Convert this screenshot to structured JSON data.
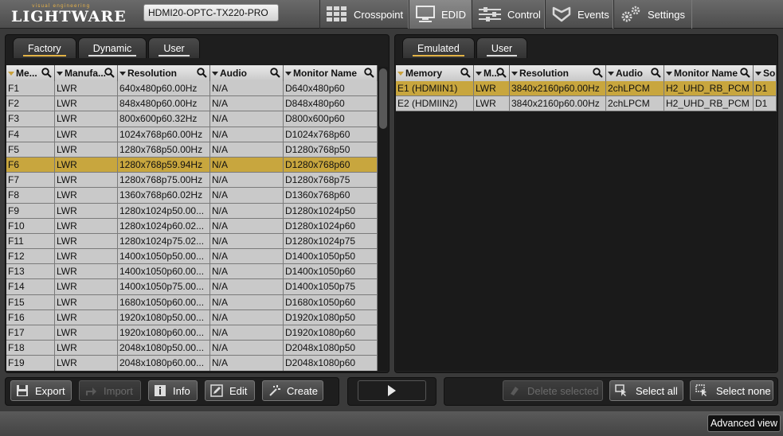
{
  "app": {
    "logo_small": "visual engineering",
    "logo": "LIGHTWARE",
    "device": "HDMI20-OPTC-TX220-PRO"
  },
  "nav": [
    {
      "label": "Crosspoint",
      "icon": "crosspoint-grid-icon"
    },
    {
      "label": "EDID",
      "icon": "monitor-icon"
    },
    {
      "label": "Control",
      "icon": "sliders-icon"
    },
    {
      "label": "Events",
      "icon": "events-chevron-icon"
    },
    {
      "label": "Settings",
      "icon": "gears-icon"
    }
  ],
  "left_tabs": [
    "Factory",
    "Dynamic",
    "User"
  ],
  "right_tabs": [
    "Emulated",
    "User"
  ],
  "left_headers": [
    "Me...",
    "Manufa...",
    "Resolution",
    "Audio",
    "Monitor Name"
  ],
  "right_headers": [
    "Memory",
    "M...",
    "Resolution",
    "Audio",
    "Monitor Name",
    "So..."
  ],
  "left_rows": [
    [
      "F1",
      "LWR",
      "640x480p60.00Hz",
      "N/A",
      "D640x480p60"
    ],
    [
      "F2",
      "LWR",
      "848x480p60.00Hz",
      "N/A",
      "D848x480p60"
    ],
    [
      "F3",
      "LWR",
      "800x600p60.32Hz",
      "N/A",
      "D800x600p60"
    ],
    [
      "F4",
      "LWR",
      "1024x768p60.00Hz",
      "N/A",
      "D1024x768p60"
    ],
    [
      "F5",
      "LWR",
      "1280x768p50.00Hz",
      "N/A",
      "D1280x768p50"
    ],
    [
      "F6",
      "LWR",
      "1280x768p59.94Hz",
      "N/A",
      "D1280x768p60"
    ],
    [
      "F7",
      "LWR",
      "1280x768p75.00Hz",
      "N/A",
      "D1280x768p75"
    ],
    [
      "F8",
      "LWR",
      "1360x768p60.02Hz",
      "N/A",
      "D1360x768p60"
    ],
    [
      "F9",
      "LWR",
      "1280x1024p50.00...",
      "N/A",
      "D1280x1024p50"
    ],
    [
      "F10",
      "LWR",
      "1280x1024p60.02...",
      "N/A",
      "D1280x1024p60"
    ],
    [
      "F11",
      "LWR",
      "1280x1024p75.02...",
      "N/A",
      "D1280x1024p75"
    ],
    [
      "F12",
      "LWR",
      "1400x1050p50.00...",
      "N/A",
      "D1400x1050p50"
    ],
    [
      "F13",
      "LWR",
      "1400x1050p60.00...",
      "N/A",
      "D1400x1050p60"
    ],
    [
      "F14",
      "LWR",
      "1400x1050p75.00...",
      "N/A",
      "D1400x1050p75"
    ],
    [
      "F15",
      "LWR",
      "1680x1050p60.00...",
      "N/A",
      "D1680x1050p60"
    ],
    [
      "F16",
      "LWR",
      "1920x1080p50.00...",
      "N/A",
      "D1920x1080p50"
    ],
    [
      "F17",
      "LWR",
      "1920x1080p60.00...",
      "N/A",
      "D1920x1080p60"
    ],
    [
      "F18",
      "LWR",
      "2048x1080p50.00...",
      "N/A",
      "D2048x1080p50"
    ],
    [
      "F19",
      "LWR",
      "2048x1080p60.00...",
      "N/A",
      "D2048x1080p60"
    ]
  ],
  "left_selected": 5,
  "right_rows": [
    [
      "E1 (HDMIIN1)",
      "LWR",
      "3840x2160p60.00Hz",
      "2chLPCM",
      "H2_UHD_RB_PCM",
      "D1"
    ],
    [
      "E2 (HDMIIN2)",
      "LWR",
      "3840x2160p60.00Hz",
      "2chLPCM",
      "H2_UHD_RB_PCM",
      "D1"
    ]
  ],
  "right_selected": 0,
  "buttons": {
    "export": "Export",
    "import": "Import",
    "info": "Info",
    "edit": "Edit",
    "create": "Create",
    "delete_selected": "Delete selected",
    "select_all": "Select all",
    "select_none": "Select none",
    "advanced_view": "Advanced view"
  },
  "colors": {
    "selected_row": "#c8a63e",
    "accent": "#e3b346"
  }
}
